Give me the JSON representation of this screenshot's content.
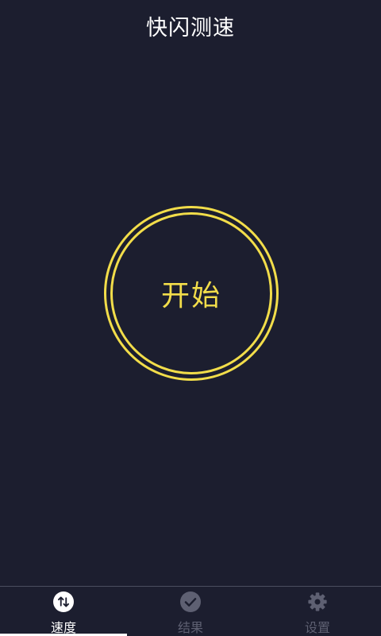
{
  "header": {
    "title": "快闪测速"
  },
  "main": {
    "start_label": "开始"
  },
  "nav": {
    "items": [
      {
        "label": "速度",
        "icon": "swap-vertical-icon",
        "active": true
      },
      {
        "label": "结果",
        "icon": "check-circle-icon",
        "active": false
      },
      {
        "label": "设置",
        "icon": "gear-icon",
        "active": false
      }
    ]
  },
  "colors": {
    "background": "#1c1e2f",
    "accent": "#f2dd4a",
    "nav_active": "#ffffff",
    "nav_inactive": "#5e6072"
  }
}
